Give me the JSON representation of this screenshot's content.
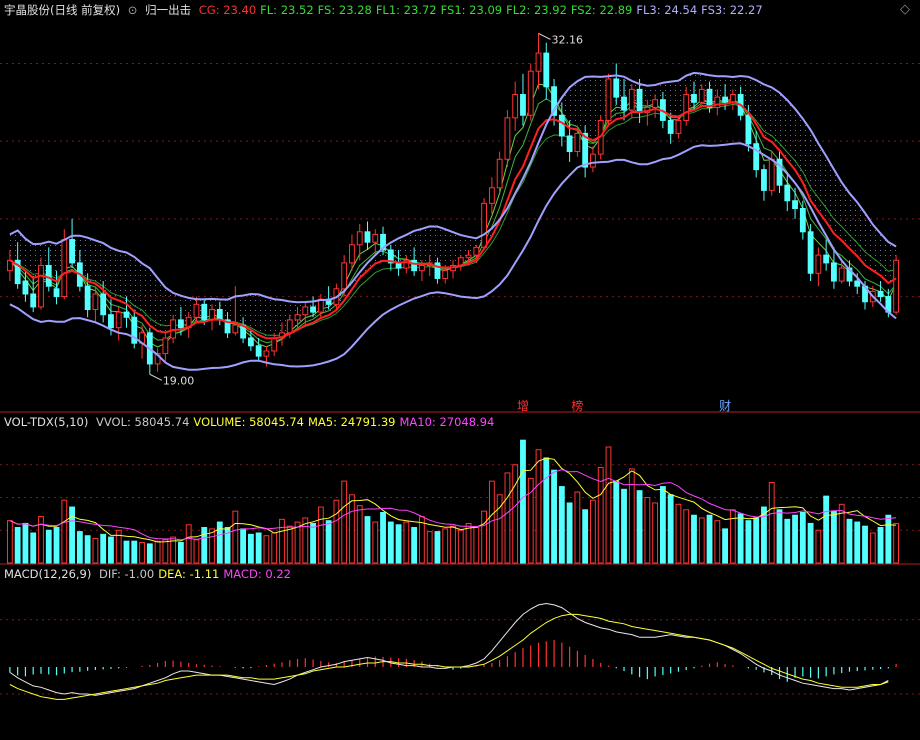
{
  "header": {
    "stock": "宇晶股份(日线 前复权)",
    "circle_icon": "circle-arrow-icon",
    "indicator": "归一出击",
    "items": [
      {
        "label": "CG: 23.40",
        "color": "#ff3030"
      },
      {
        "label": "FL: 23.52",
        "color": "#33dd33"
      },
      {
        "label": "FS: 23.28",
        "color": "#33dd33"
      },
      {
        "label": "FL1: 23.72",
        "color": "#33dd33"
      },
      {
        "label": "FS1: 23.09",
        "color": "#33dd33"
      },
      {
        "label": "FL2: 23.92",
        "color": "#33dd33"
      },
      {
        "label": "FS2: 22.89",
        "color": "#33dd33"
      },
      {
        "label": "FL3: 24.54",
        "color": "#b0b0ff"
      },
      {
        "label": "FS3: 22.27",
        "color": "#b0b0ff"
      }
    ],
    "corner_icon": "diamond-icon"
  },
  "vol_header": {
    "name": "VOL-TDX(5,10)",
    "items": [
      {
        "label": "VVOL: 58045.74",
        "color": "#c8c8c8"
      },
      {
        "label": "VOLUME: 58045.74",
        "color": "#ffff33"
      },
      {
        "label": "MA5: 24791.39",
        "color": "#ffff33"
      },
      {
        "label": "MA10: 27048.94",
        "color": "#ff44ff"
      }
    ]
  },
  "macd_header": {
    "name": "MACD(12,26,9)",
    "items": [
      {
        "label": "DIF: -1.00",
        "color": "#c8c8c8"
      },
      {
        "label": "DEA: -1.11",
        "color": "#ffff33"
      },
      {
        "label": "MACD: 0.22",
        "color": "#ff44ff"
      }
    ]
  },
  "colors": {
    "up": "#ff3333",
    "down": "#54ffff",
    "grid": "#7a1a1a",
    "band": "#a0a0ff",
    "cg": "#ff2020",
    "fl": "#33cc33"
  },
  "chart_data": {
    "type": "candlestick",
    "price_annotations": [
      {
        "label": "32.16",
        "kind": "high"
      },
      {
        "label": "19.00",
        "kind": "low"
      }
    ],
    "event_markers": [
      "增",
      "榜",
      "财"
    ],
    "candles": [
      {
        "o": 23.0,
        "h": 23.8,
        "l": 22.6,
        "c": 23.4
      },
      {
        "o": 23.4,
        "h": 24.1,
        "l": 22.3,
        "c": 22.5
      },
      {
        "o": 22.6,
        "h": 23.0,
        "l": 21.8,
        "c": 22.1
      },
      {
        "o": 22.1,
        "h": 22.8,
        "l": 21.4,
        "c": 21.6
      },
      {
        "o": 21.6,
        "h": 23.5,
        "l": 21.5,
        "c": 23.2
      },
      {
        "o": 23.2,
        "h": 23.9,
        "l": 22.2,
        "c": 22.4
      },
      {
        "o": 22.3,
        "h": 23.0,
        "l": 21.7,
        "c": 22.0
      },
      {
        "o": 22.0,
        "h": 24.6,
        "l": 21.9,
        "c": 24.2
      },
      {
        "o": 24.2,
        "h": 25.0,
        "l": 23.1,
        "c": 23.3
      },
      {
        "o": 23.3,
        "h": 23.8,
        "l": 22.2,
        "c": 22.4
      },
      {
        "o": 22.4,
        "h": 22.9,
        "l": 21.2,
        "c": 21.5
      },
      {
        "o": 21.5,
        "h": 22.4,
        "l": 21.0,
        "c": 22.1
      },
      {
        "o": 22.1,
        "h": 22.6,
        "l": 21.0,
        "c": 21.3
      },
      {
        "o": 21.3,
        "h": 21.9,
        "l": 20.5,
        "c": 20.8
      },
      {
        "o": 20.8,
        "h": 21.6,
        "l": 20.3,
        "c": 21.4
      },
      {
        "o": 21.4,
        "h": 22.0,
        "l": 20.8,
        "c": 21.2
      },
      {
        "o": 21.2,
        "h": 21.5,
        "l": 20.0,
        "c": 20.2
      },
      {
        "o": 20.2,
        "h": 20.9,
        "l": 19.6,
        "c": 20.6
      },
      {
        "o": 20.6,
        "h": 20.8,
        "l": 19.0,
        "c": 19.4
      },
      {
        "o": 19.4,
        "h": 20.0,
        "l": 19.1,
        "c": 19.8
      },
      {
        "o": 19.8,
        "h": 20.6,
        "l": 19.5,
        "c": 20.4
      },
      {
        "o": 20.4,
        "h": 21.3,
        "l": 20.2,
        "c": 21.1
      },
      {
        "o": 21.1,
        "h": 21.6,
        "l": 20.5,
        "c": 20.8
      },
      {
        "o": 20.8,
        "h": 21.4,
        "l": 20.4,
        "c": 21.2
      },
      {
        "o": 21.2,
        "h": 22.0,
        "l": 21.0,
        "c": 21.7
      },
      {
        "o": 21.7,
        "h": 21.9,
        "l": 20.9,
        "c": 21.1
      },
      {
        "o": 21.1,
        "h": 21.7,
        "l": 20.7,
        "c": 21.5
      },
      {
        "o": 21.5,
        "h": 21.8,
        "l": 20.9,
        "c": 21.1
      },
      {
        "o": 21.1,
        "h": 21.4,
        "l": 20.4,
        "c": 20.6
      },
      {
        "o": 20.6,
        "h": 22.4,
        "l": 20.5,
        "c": 20.9
      },
      {
        "o": 20.9,
        "h": 21.2,
        "l": 20.2,
        "c": 20.4
      },
      {
        "o": 20.4,
        "h": 20.7,
        "l": 19.9,
        "c": 20.1
      },
      {
        "o": 20.1,
        "h": 20.4,
        "l": 19.5,
        "c": 19.7
      },
      {
        "o": 19.7,
        "h": 20.1,
        "l": 19.3,
        "c": 19.9
      },
      {
        "o": 19.9,
        "h": 20.6,
        "l": 19.7,
        "c": 20.4
      },
      {
        "o": 20.4,
        "h": 21.0,
        "l": 20.1,
        "c": 20.6
      },
      {
        "o": 20.6,
        "h": 21.3,
        "l": 20.4,
        "c": 21.1
      },
      {
        "o": 21.1,
        "h": 21.6,
        "l": 20.8,
        "c": 21.3
      },
      {
        "o": 21.3,
        "h": 21.8,
        "l": 20.9,
        "c": 21.6
      },
      {
        "o": 21.6,
        "h": 22.0,
        "l": 21.2,
        "c": 21.4
      },
      {
        "o": 21.4,
        "h": 22.1,
        "l": 21.2,
        "c": 21.9
      },
      {
        "o": 21.9,
        "h": 22.4,
        "l": 21.5,
        "c": 21.7
      },
      {
        "o": 21.7,
        "h": 22.5,
        "l": 21.5,
        "c": 22.3
      },
      {
        "o": 22.3,
        "h": 23.6,
        "l": 22.0,
        "c": 23.3
      },
      {
        "o": 23.3,
        "h": 24.4,
        "l": 23.0,
        "c": 24.0
      },
      {
        "o": 24.0,
        "h": 24.8,
        "l": 23.4,
        "c": 24.5
      },
      {
        "o": 24.5,
        "h": 24.9,
        "l": 23.8,
        "c": 24.1
      },
      {
        "o": 24.1,
        "h": 24.6,
        "l": 23.6,
        "c": 24.4
      },
      {
        "o": 24.4,
        "h": 24.7,
        "l": 23.6,
        "c": 23.8
      },
      {
        "o": 23.8,
        "h": 24.0,
        "l": 23.0,
        "c": 23.3
      },
      {
        "o": 23.3,
        "h": 23.8,
        "l": 22.8,
        "c": 23.1
      },
      {
        "o": 23.1,
        "h": 23.6,
        "l": 22.9,
        "c": 23.4
      },
      {
        "o": 23.4,
        "h": 23.9,
        "l": 22.8,
        "c": 23.0
      },
      {
        "o": 23.0,
        "h": 23.4,
        "l": 22.6,
        "c": 23.2
      },
      {
        "o": 23.2,
        "h": 23.6,
        "l": 22.8,
        "c": 23.3
      },
      {
        "o": 23.3,
        "h": 23.5,
        "l": 22.5,
        "c": 22.7
      },
      {
        "o": 22.7,
        "h": 23.2,
        "l": 22.5,
        "c": 23.0
      },
      {
        "o": 23.0,
        "h": 23.4,
        "l": 22.7,
        "c": 23.2
      },
      {
        "o": 23.2,
        "h": 23.6,
        "l": 23.0,
        "c": 23.5
      },
      {
        "o": 23.5,
        "h": 23.8,
        "l": 23.2,
        "c": 23.6
      },
      {
        "o": 23.6,
        "h": 24.0,
        "l": 23.3,
        "c": 23.9
      },
      {
        "o": 23.9,
        "h": 25.8,
        "l": 23.8,
        "c": 25.6
      },
      {
        "o": 25.6,
        "h": 26.6,
        "l": 25.2,
        "c": 26.2
      },
      {
        "o": 26.2,
        "h": 27.6,
        "l": 26.0,
        "c": 27.3
      },
      {
        "o": 27.3,
        "h": 29.2,
        "l": 27.0,
        "c": 28.9
      },
      {
        "o": 28.9,
        "h": 30.3,
        "l": 28.4,
        "c": 29.8
      },
      {
        "o": 29.8,
        "h": 30.6,
        "l": 28.6,
        "c": 29.0
      },
      {
        "o": 29.0,
        "h": 31.0,
        "l": 28.8,
        "c": 30.7
      },
      {
        "o": 30.7,
        "h": 32.16,
        "l": 30.0,
        "c": 31.4
      },
      {
        "o": 31.4,
        "h": 31.8,
        "l": 29.6,
        "c": 30.1
      },
      {
        "o": 30.1,
        "h": 30.4,
        "l": 28.6,
        "c": 29.0
      },
      {
        "o": 29.0,
        "h": 29.5,
        "l": 27.8,
        "c": 28.2
      },
      {
        "o": 28.2,
        "h": 28.8,
        "l": 27.2,
        "c": 27.6
      },
      {
        "o": 27.6,
        "h": 28.6,
        "l": 27.4,
        "c": 28.3
      },
      {
        "o": 28.3,
        "h": 28.6,
        "l": 26.6,
        "c": 27.0
      },
      {
        "o": 27.0,
        "h": 27.8,
        "l": 26.8,
        "c": 27.5
      },
      {
        "o": 27.5,
        "h": 29.0,
        "l": 27.3,
        "c": 28.8
      },
      {
        "o": 28.8,
        "h": 30.6,
        "l": 28.6,
        "c": 30.4
      },
      {
        "o": 30.4,
        "h": 31.0,
        "l": 29.4,
        "c": 29.7
      },
      {
        "o": 29.7,
        "h": 30.4,
        "l": 28.8,
        "c": 29.2
      },
      {
        "o": 29.2,
        "h": 30.2,
        "l": 28.9,
        "c": 30.0
      },
      {
        "o": 30.0,
        "h": 30.4,
        "l": 28.7,
        "c": 29.1
      },
      {
        "o": 29.1,
        "h": 29.6,
        "l": 28.6,
        "c": 29.3
      },
      {
        "o": 29.3,
        "h": 29.8,
        "l": 28.9,
        "c": 29.6
      },
      {
        "o": 29.6,
        "h": 29.9,
        "l": 28.5,
        "c": 28.8
      },
      {
        "o": 28.8,
        "h": 29.1,
        "l": 27.9,
        "c": 28.3
      },
      {
        "o": 28.3,
        "h": 29.0,
        "l": 28.1,
        "c": 28.8
      },
      {
        "o": 28.8,
        "h": 30.1,
        "l": 28.6,
        "c": 29.8
      },
      {
        "o": 29.8,
        "h": 30.3,
        "l": 29.2,
        "c": 29.5
      },
      {
        "o": 29.5,
        "h": 30.2,
        "l": 29.3,
        "c": 30.0
      },
      {
        "o": 30.0,
        "h": 30.3,
        "l": 29.1,
        "c": 29.3
      },
      {
        "o": 29.3,
        "h": 30.0,
        "l": 29.0,
        "c": 29.7
      },
      {
        "o": 29.7,
        "h": 30.2,
        "l": 29.2,
        "c": 29.5
      },
      {
        "o": 29.5,
        "h": 30.0,
        "l": 29.2,
        "c": 29.8
      },
      {
        "o": 29.8,
        "h": 30.1,
        "l": 28.8,
        "c": 29.0
      },
      {
        "o": 29.0,
        "h": 29.4,
        "l": 27.6,
        "c": 27.9
      },
      {
        "o": 27.9,
        "h": 28.4,
        "l": 26.6,
        "c": 26.9
      },
      {
        "o": 26.9,
        "h": 27.1,
        "l": 25.7,
        "c": 26.1
      },
      {
        "o": 26.1,
        "h": 27.6,
        "l": 25.9,
        "c": 27.3
      },
      {
        "o": 27.3,
        "h": 27.7,
        "l": 26.0,
        "c": 26.3
      },
      {
        "o": 26.3,
        "h": 26.8,
        "l": 25.3,
        "c": 25.7
      },
      {
        "o": 25.7,
        "h": 26.2,
        "l": 25.0,
        "c": 25.4
      },
      {
        "o": 25.4,
        "h": 25.7,
        "l": 24.2,
        "c": 24.5
      },
      {
        "o": 24.5,
        "h": 24.8,
        "l": 22.6,
        "c": 22.9
      },
      {
        "o": 22.9,
        "h": 23.9,
        "l": 22.4,
        "c": 23.6
      },
      {
        "o": 23.6,
        "h": 24.2,
        "l": 23.0,
        "c": 23.3
      },
      {
        "o": 23.3,
        "h": 23.9,
        "l": 22.3,
        "c": 22.6
      },
      {
        "o": 22.6,
        "h": 23.4,
        "l": 22.5,
        "c": 23.1
      },
      {
        "o": 23.1,
        "h": 23.4,
        "l": 22.4,
        "c": 22.6
      },
      {
        "o": 22.6,
        "h": 22.9,
        "l": 22.1,
        "c": 22.4
      },
      {
        "o": 22.4,
        "h": 22.6,
        "l": 21.5,
        "c": 21.8
      },
      {
        "o": 21.8,
        "h": 22.4,
        "l": 21.6,
        "c": 22.2
      },
      {
        "o": 22.2,
        "h": 22.6,
        "l": 21.8,
        "c": 22.0
      },
      {
        "o": 22.0,
        "h": 22.3,
        "l": 21.2,
        "c": 21.4
      },
      {
        "o": 21.4,
        "h": 23.6,
        "l": 21.3,
        "c": 23.4
      }
    ],
    "volume": [
      3.1,
      2.6,
      2.9,
      2.2,
      3.4,
      2.4,
      2.6,
      4.6,
      4.1,
      2.3,
      2.0,
      1.8,
      2.1,
      1.9,
      2.4,
      1.6,
      1.6,
      1.5,
      1.4,
      1.6,
      1.7,
      1.9,
      1.5,
      2.8,
      1.7,
      2.6,
      2.5,
      3.0,
      2.6,
      3.8,
      2.5,
      2.1,
      2.2,
      2.0,
      2.2,
      3.2,
      2.7,
      3.0,
      3.3,
      2.9,
      4.1,
      3.1,
      4.6,
      6.0,
      5.0,
      4.2,
      3.4,
      3.0,
      3.7,
      3.0,
      2.8,
      3.0,
      2.6,
      3.4,
      2.3,
      2.3,
      2.5,
      2.7,
      2.4,
      2.9,
      2.6,
      3.8,
      6.0,
      5.0,
      6.6,
      7.2,
      9.0,
      6.2,
      8.3,
      7.7,
      6.8,
      5.6,
      4.4,
      5.2,
      3.9,
      4.6,
      7.0,
      8.5,
      6.0,
      5.4,
      6.9,
      5.3,
      4.8,
      4.4,
      5.6,
      5.0,
      4.3,
      3.9,
      3.5,
      3.3,
      3.5,
      3.1,
      2.5,
      3.9,
      3.6,
      3.1,
      3.3,
      4.1,
      5.9,
      3.9,
      3.2,
      3.5,
      3.7,
      2.9,
      2.4,
      4.9,
      3.8,
      4.3,
      3.2,
      3.0,
      2.7,
      2.2,
      2.6,
      3.5,
      2.9
    ],
    "macd_hist": [
      -0.4,
      -0.62,
      -0.7,
      -0.56,
      -0.5,
      -0.55,
      -0.62,
      -0.48,
      -0.38,
      -0.35,
      -0.28,
      -0.22,
      -0.18,
      -0.14,
      -0.1,
      -0.05,
      0.0,
      0.08,
      0.15,
      0.3,
      0.45,
      0.48,
      0.4,
      0.3,
      0.2,
      0.15,
      0.1,
      0.05,
      0.0,
      -0.05,
      -0.1,
      -0.08,
      0.05,
      0.15,
      0.25,
      0.35,
      0.5,
      0.6,
      0.65,
      0.55,
      0.45,
      0.35,
      0.3,
      0.38,
      0.5,
      0.62,
      0.7,
      0.78,
      0.75,
      0.7,
      0.65,
      0.6,
      0.52,
      0.4,
      0.25,
      0.1,
      0.0,
      -0.2,
      -0.12,
      -0.05,
      0.05,
      0.15,
      0.3,
      0.5,
      0.8,
      1.1,
      1.4,
      1.6,
      1.8,
      1.9,
      2.0,
      1.8,
      1.5,
      1.2,
      0.9,
      0.6,
      0.3,
      0.1,
      -0.1,
      -0.3,
      -0.55,
      -0.75,
      -0.9,
      -0.7,
      -0.6,
      -0.48,
      -0.35,
      -0.22,
      -0.1,
      0.1,
      0.25,
      0.35,
      0.22,
      0.12,
      0.0,
      -0.1,
      -0.2,
      -0.4,
      -0.6,
      -0.9,
      -1.1,
      -0.8,
      -0.7,
      -0.8,
      -0.85,
      -0.7,
      -0.55,
      -0.45,
      -0.35,
      -0.3,
      -0.25,
      -0.2,
      -0.15,
      -0.1,
      0.22
    ],
    "dif": [
      -0.4,
      -0.8,
      -1.1,
      -1.4,
      -1.5,
      -1.7,
      -1.9,
      -2.0,
      -1.9,
      -2.0,
      -2.0,
      -2.1,
      -2.0,
      -1.9,
      -1.8,
      -1.7,
      -1.6,
      -1.4,
      -1.2,
      -1.0,
      -0.8,
      -0.5,
      -0.3,
      -0.3,
      -0.4,
      -0.5,
      -0.6,
      -0.6,
      -0.7,
      -0.8,
      -0.9,
      -1.0,
      -1.1,
      -1.2,
      -1.3,
      -1.1,
      -0.9,
      -0.6,
      -0.4,
      -0.2,
      0.0,
      0.1,
      0.2,
      0.4,
      0.5,
      0.6,
      0.7,
      0.6,
      0.5,
      0.3,
      0.2,
      0.1,
      0.1,
      0.0,
      0.0,
      -0.1,
      -0.1,
      0.0,
      0.0,
      0.1,
      0.3,
      0.6,
      1.2,
      1.9,
      2.6,
      3.3,
      3.9,
      4.3,
      4.6,
      4.7,
      4.6,
      4.4,
      4.0,
      3.6,
      3.3,
      3.1,
      2.9,
      2.8,
      2.6,
      2.5,
      2.4,
      2.2,
      2.2,
      2.2,
      2.3,
      2.4,
      2.3,
      2.2,
      2.2,
      2.1,
      2.0,
      1.8,
      1.6,
      1.3,
      1.0,
      0.6,
      0.2,
      -0.1,
      -0.3,
      -0.6,
      -0.8,
      -1.0,
      -1.2,
      -1.3,
      -1.4,
      -1.5,
      -1.6,
      -1.6,
      -1.7,
      -1.6,
      -1.5,
      -1.4,
      -1.3,
      -1.0
    ],
    "dea": [
      -1.3,
      -1.6,
      -1.8,
      -2.0,
      -2.2,
      -2.3,
      -2.4,
      -2.4,
      -2.3,
      -2.2,
      -2.1,
      -2.0,
      -1.9,
      -1.8,
      -1.7,
      -1.6,
      -1.5,
      -1.4,
      -1.3,
      -1.2,
      -1.0,
      -0.9,
      -0.8,
      -0.7,
      -0.6,
      -0.6,
      -0.6,
      -0.6,
      -0.6,
      -0.7,
      -0.8,
      -0.8,
      -0.9,
      -0.9,
      -0.9,
      -0.8,
      -0.7,
      -0.6,
      -0.5,
      -0.3,
      -0.2,
      -0.1,
      0.0,
      0.0,
      0.1,
      0.2,
      0.3,
      0.3,
      0.4,
      0.4,
      0.3,
      0.3,
      0.2,
      0.2,
      0.1,
      0.1,
      0.0,
      0.0,
      0.0,
      0.0,
      0.1,
      0.2,
      0.5,
      0.8,
      1.2,
      1.6,
      2.0,
      2.5,
      2.9,
      3.3,
      3.6,
      3.8,
      3.9,
      3.9,
      3.8,
      3.7,
      3.6,
      3.4,
      3.3,
      3.2,
      3.0,
      2.9,
      2.8,
      2.7,
      2.6,
      2.5,
      2.4,
      2.3,
      2.2,
      2.1,
      2.0,
      1.8,
      1.6,
      1.4,
      1.1,
      0.8,
      0.5,
      0.2,
      -0.1,
      -0.3,
      -0.5,
      -0.7,
      -0.9,
      -1.0,
      -1.2,
      -1.3,
      -1.4,
      -1.5,
      -1.5,
      -1.5,
      -1.4,
      -1.3,
      -1.3,
      -1.1
    ]
  }
}
